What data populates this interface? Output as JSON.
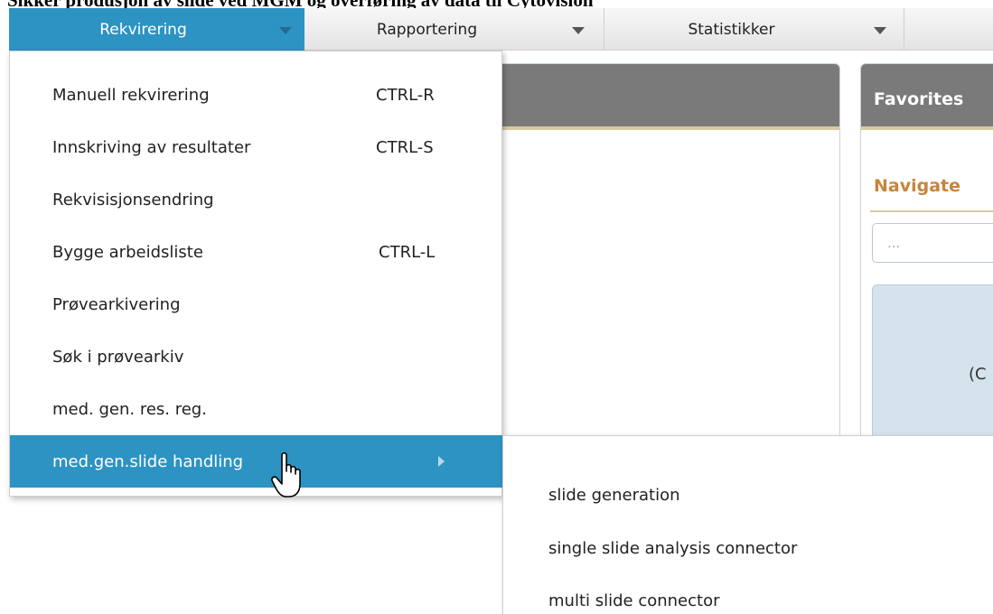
{
  "document_title": "Sikker produsjon av slide ved MGM og overføring av data til Cytovision",
  "menubar": {
    "tabs": [
      {
        "label": "Rekvirering",
        "active": true
      },
      {
        "label": "Rapportering",
        "active": false
      },
      {
        "label": "Statistikker",
        "active": false
      }
    ]
  },
  "panels": {
    "favorites_title": "Favorites",
    "navigate_label": "Navigate",
    "navigate_placeholder": "...",
    "info_text": "(C"
  },
  "dropdown": {
    "items": [
      {
        "label": "Manuell rekvirering",
        "shortcut": "CTRL-R"
      },
      {
        "label": "Innskriving av resultater",
        "shortcut": "CTRL-S"
      },
      {
        "label": "Rekvisisjonsendring",
        "shortcut": ""
      },
      {
        "label": "Bygge arbeidsliste",
        "shortcut": "CTRL-L"
      },
      {
        "label": "Prøvearkivering",
        "shortcut": ""
      },
      {
        "label": "Søk i prøvearkiv",
        "shortcut": ""
      },
      {
        "label": "med. gen. res. reg.",
        "shortcut": ""
      },
      {
        "label": "med.gen.slide handling",
        "shortcut": "",
        "highlighted": true,
        "has_submenu": true
      }
    ]
  },
  "submenu": {
    "items": [
      {
        "label": "slide generation"
      },
      {
        "label": "single slide analysis connector"
      },
      {
        "label": "multi slide connector"
      }
    ]
  },
  "colors": {
    "accent": "#2d93c3",
    "panel_header": "#7a7a7a",
    "navigate_label": "#c8843a"
  }
}
